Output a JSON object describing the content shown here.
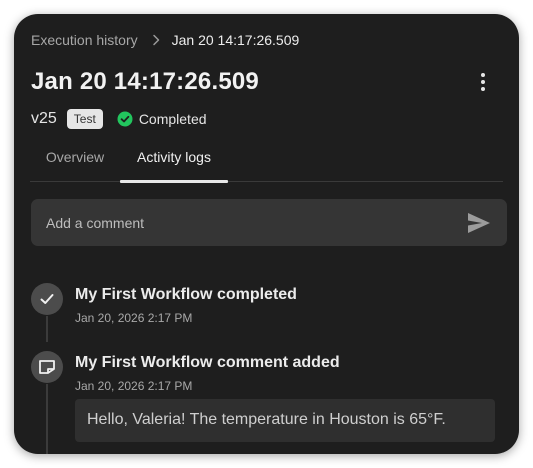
{
  "breadcrumb": {
    "parent": "Execution history",
    "current": "Jan 20 14:17:26.509"
  },
  "header": {
    "title": "Jan 20 14:17:26.509",
    "version": "v25",
    "badge": "Test",
    "status": "Completed",
    "status_color": "#22c55e"
  },
  "tabs": [
    {
      "label": "Overview",
      "active": false
    },
    {
      "label": "Activity logs",
      "active": true
    }
  ],
  "comment": {
    "placeholder": "Add a comment",
    "value": ""
  },
  "activity": [
    {
      "icon": "check-icon",
      "title": "My First Workflow completed",
      "time": "Jan 20, 2026 2:17 PM"
    },
    {
      "icon": "note-icon",
      "title": "My First Workflow comment added",
      "time": "Jan 20, 2026 2:17 PM",
      "comment": "Hello, Valeria! The temperature in Houston is 65°F."
    }
  ],
  "colors": {
    "panel": "#1e1e1e",
    "accent": "#e8e8e8"
  }
}
